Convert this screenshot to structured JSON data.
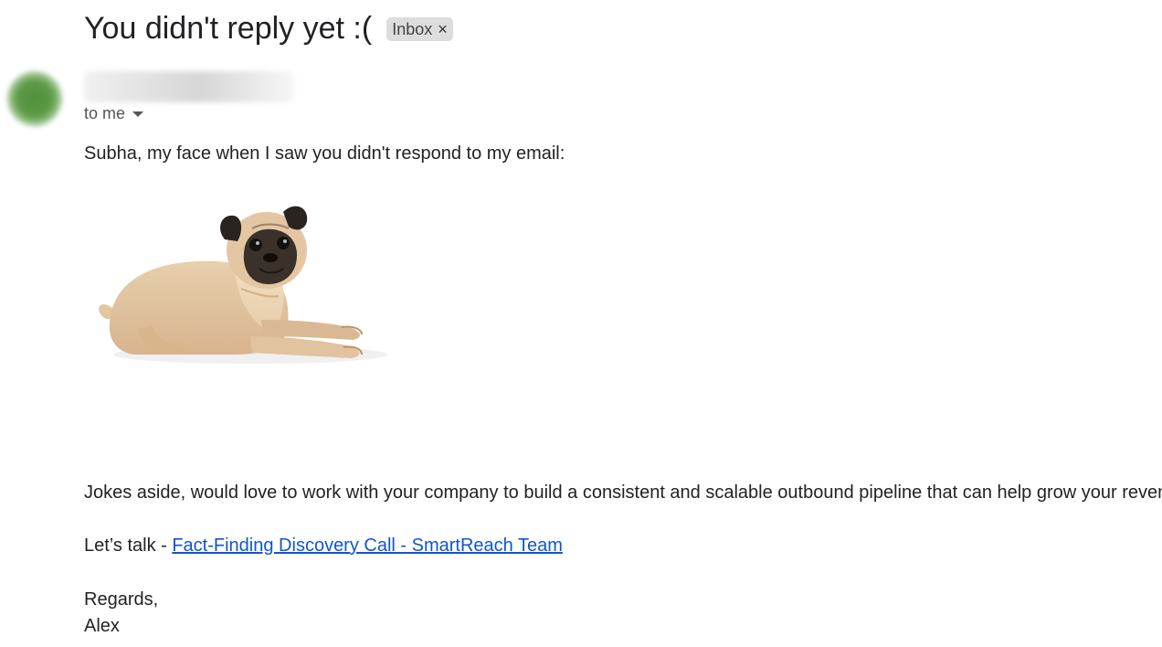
{
  "email": {
    "subject": "You didn't reply yet :(",
    "label_chip": "Inbox",
    "label_remove_icon": "close-icon",
    "recipient_text": "to me",
    "recipient_dropdown_icon": "chevron-down-icon"
  },
  "body": {
    "greeting_line": "Subha, my face when I saw you didn't respond to my email:",
    "image_alt": "pug",
    "pitch_line": "Jokes aside, would love to work with your company to build a consistent and scalable outbound pipeline that can help grow your revenue",
    "cta_prefix": "Let’s talk - ",
    "cta_link": "Fact-Finding Discovery Call - SmartReach Team",
    "signoff": "Regards,",
    "signature": "Alex"
  },
  "colors": {
    "link": "#1155cc",
    "chip_bg": "#dddddd",
    "avatar": "#4f8f3a"
  }
}
